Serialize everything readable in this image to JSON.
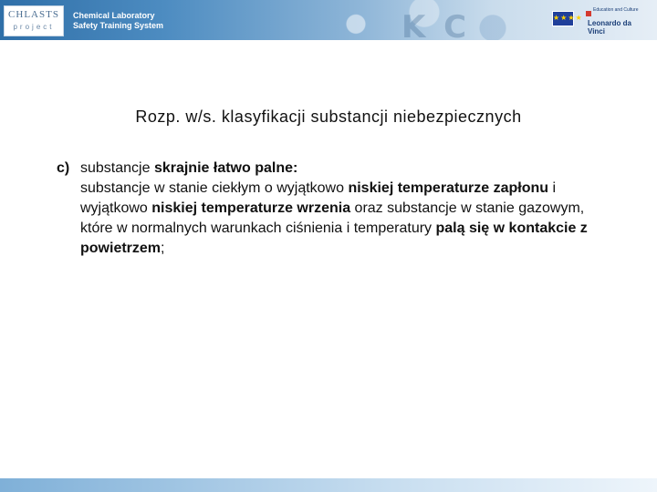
{
  "header": {
    "logo_top": "CHLASTS",
    "logo_bottom": "project",
    "title_line1": "Chemical Laboratory",
    "title_line2": "Safety Training System",
    "eu_flag_stars": "★★★★",
    "ldv_subtitle": "Education and Culture",
    "ldv_name": "Leonardo da Vinci"
  },
  "slide": {
    "heading": "Rozp. w/s. klasyfikacji substancji niebezpiecznych",
    "item": {
      "marker": "c)",
      "line1_plain": "substancje ",
      "line1_bold": "skrajnie łatwo palne:",
      "segments": [
        {
          "text": "substancje w stanie ciekłym o wyjątkowo ",
          "bold": false
        },
        {
          "text": "niskiej temperaturze zapłonu",
          "bold": true
        },
        {
          "text": " i wyjątkowo ",
          "bold": false
        },
        {
          "text": "niskiej temperaturze wrzenia",
          "bold": true
        },
        {
          "text": " oraz substancje w stanie gazowym, które w normalnych warunkach ciśnienia i temperatury ",
          "bold": false
        },
        {
          "text": "palą się w kontakcie z powietrzem",
          "bold": true
        },
        {
          "text": ";",
          "bold": false
        }
      ]
    }
  },
  "colors": {
    "banner_start": "#2f6fa8",
    "banner_end": "#e6eef6",
    "text": "#111111"
  }
}
